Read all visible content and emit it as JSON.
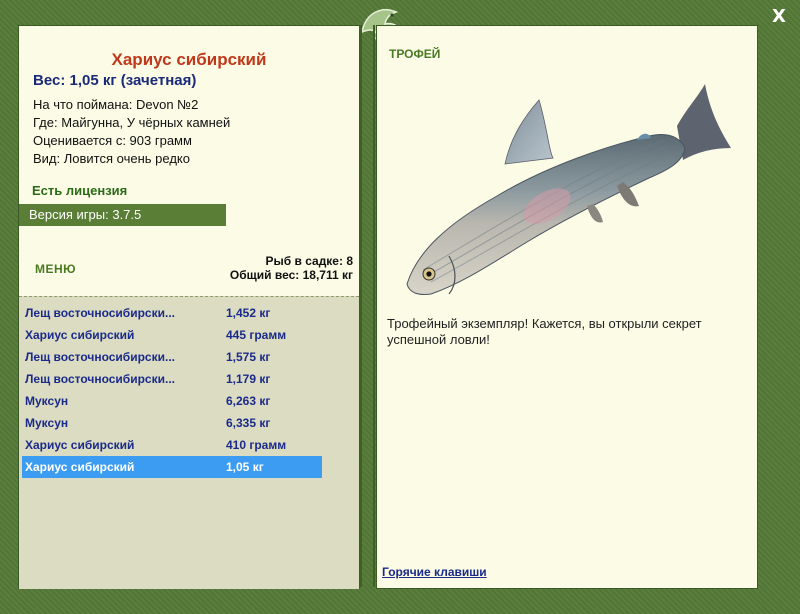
{
  "window": {
    "close_label": "X"
  },
  "logo": {
    "icon": "fish-logo-icon"
  },
  "fish": {
    "name": "Хариус сибирский",
    "weight_line": "Вес: 1,05 кг (зачетная)",
    "info": [
      "На что поймана: Devon №2",
      "Где: Майгунна, У чёрных камней",
      "Оценивается с: 903 грамм",
      "Вид: Ловится очень редко"
    ]
  },
  "license": "Есть лицензия",
  "version": "Версия игры: 3.7.5",
  "menu_label": "МЕНЮ",
  "stats": {
    "fish_count": "Рыб в садке: 8",
    "total_weight": "Общий вес: 18,711 кг"
  },
  "catch_list": [
    {
      "name": "Лещ восточносибирски...",
      "weight": "1,452 кг",
      "selected": false
    },
    {
      "name": "Хариус сибирский",
      "weight": "445 грамм",
      "selected": false
    },
    {
      "name": "Лещ восточносибирски...",
      "weight": "1,575 кг",
      "selected": false
    },
    {
      "name": "Лещ восточносибирски...",
      "weight": "1,179 кг",
      "selected": false
    },
    {
      "name": "Муксун",
      "weight": "6,263 кг",
      "selected": false
    },
    {
      "name": "Муксун",
      "weight": "6,335 кг",
      "selected": false
    },
    {
      "name": "Хариус сибирский",
      "weight": "410 грамм",
      "selected": false
    },
    {
      "name": "Хариус сибирский",
      "weight": "1,05 кг",
      "selected": true
    }
  ],
  "trophy": {
    "title": "ТРОФЕЙ",
    "text": "Трофейный экземпляр! Кажется, вы открыли секрет успешной ловли!"
  },
  "hotkeys_link": "Горячие клавиши",
  "colors": {
    "frame": "#557a38",
    "panel": "#fbfbe6",
    "list_bg": "#dcdcc2",
    "title_red": "#c0391b",
    "link_blue": "#1a2a8a",
    "selected": "#3b9cf2"
  }
}
